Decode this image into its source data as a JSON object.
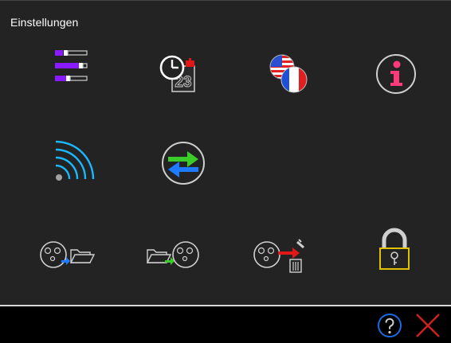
{
  "window": {
    "title": "Einstellungen"
  },
  "grid": {
    "items": [
      {
        "name": "display-settings-button",
        "icon": "sliders-icon"
      },
      {
        "name": "date-time-button",
        "icon": "clock-calendar-icon"
      },
      {
        "name": "language-button",
        "icon": "flags-icon"
      },
      {
        "name": "info-button",
        "icon": "info-icon"
      },
      {
        "name": "wifi-button",
        "icon": "wifi-icon"
      },
      {
        "name": "sync-button",
        "icon": "sync-arrows-icon"
      },
      {
        "name": "export-profile-button",
        "icon": "face-to-folder-icon"
      },
      {
        "name": "import-profile-button",
        "icon": "folder-to-face-icon"
      },
      {
        "name": "delete-profile-button",
        "icon": "face-to-trash-icon"
      },
      {
        "name": "lock-button",
        "icon": "padlock-icon"
      }
    ]
  },
  "calendar_icon_text": "23",
  "bottom_bar": {
    "help_icon": "help-icon",
    "close_icon": "close-icon"
  },
  "colors": {
    "background": "#232323",
    "purple": "#8a1aff",
    "pink": "#ff3a7a",
    "cyan": "#1ab8ff",
    "green": "#3ccc2a",
    "blue": "#1e7aff",
    "red": "#e01818",
    "yellow": "#e0c000",
    "close_red": "#d02020"
  }
}
